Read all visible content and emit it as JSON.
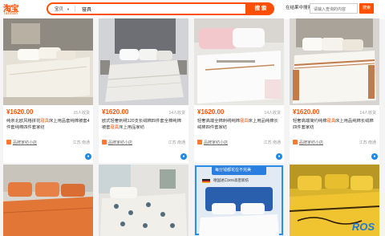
{
  "header": {
    "logo_main": "淘宝",
    "logo_sub": "Taobao",
    "search_category": "宝贝",
    "search_query": "寝具",
    "search_button": "搜 索",
    "store_search_label": "在结果中搜索",
    "store_search_placeholder": "请输入查询的内容",
    "store_search_button": "搜索"
  },
  "products": [
    {
      "price": "¥1620.00",
      "sales": "15人收货",
      "title_before": "纯亲北欧风格拼花",
      "title_hl": "寝具",
      "title_after": "床上用品套纯棉被套4件套纯棉四件套家纺",
      "shop": "品牌家纺小店",
      "location": "江苏 南通"
    },
    {
      "price": "¥1620.00",
      "sales": "14人收货",
      "title_before": "欧式轻奢刺绣120支长绒棉四件套全棉纯棉被套",
      "title_hl": "寝具",
      "title_after": "床上用品家纺",
      "shop": "品牌家纺小店",
      "location": "江苏 南通"
    },
    {
      "price": "¥1620.00",
      "sales": "14人收货",
      "title_before": "轻奢高端全棉刺绣纯棉",
      "title_hl": "寝具",
      "title_after": "床上用品纯棉长绒棉四件套家纺",
      "shop": "品牌家纺小店",
      "location": "江苏 南通"
    },
    {
      "price": "¥1620.00",
      "sales": "14人收货",
      "title_before": "轻奢高端简约纯棉",
      "title_hl": "寝具",
      "title_after": "床上用品纯棉长绒棉四件套家纺",
      "shop": "品牌家纺小店",
      "location": "江苏 南通"
    }
  ],
  "bottom_cards": {
    "badge_top": "每分钱都花在不完美",
    "badge_sub": "德国进口30S高密新纺",
    "watermark": "ROS"
  }
}
